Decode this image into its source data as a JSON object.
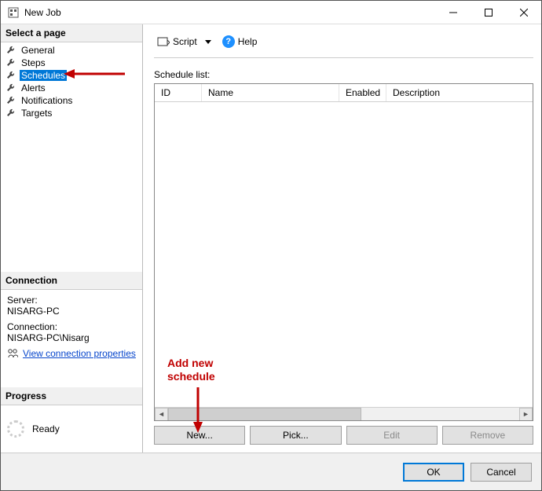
{
  "window": {
    "title": "New Job"
  },
  "sidebar": {
    "select_page_header": "Select a page",
    "pages": [
      {
        "label": "General",
        "selected": false
      },
      {
        "label": "Steps",
        "selected": false
      },
      {
        "label": "Schedules",
        "selected": true
      },
      {
        "label": "Alerts",
        "selected": false
      },
      {
        "label": "Notifications",
        "selected": false
      },
      {
        "label": "Targets",
        "selected": false
      }
    ],
    "connection_header": "Connection",
    "server_label": "Server:",
    "server_value": "NISARG-PC",
    "connection_label": "Connection:",
    "connection_value": "NISARG-PC\\Nisarg",
    "view_connection_link": "View connection properties",
    "progress_header": "Progress",
    "progress_status": "Ready"
  },
  "toolbar": {
    "script_label": "Script",
    "help_label": "Help"
  },
  "schedules": {
    "list_label": "Schedule list:",
    "columns": {
      "id": "ID",
      "name": "Name",
      "enabled": "Enabled",
      "desc": "Description"
    },
    "buttons": {
      "new": "New...",
      "pick": "Pick...",
      "edit": "Edit",
      "remove": "Remove"
    }
  },
  "footer": {
    "ok": "OK",
    "cancel": "Cancel"
  },
  "annotations": {
    "add_new_schedule": "Add new\nschedule"
  }
}
